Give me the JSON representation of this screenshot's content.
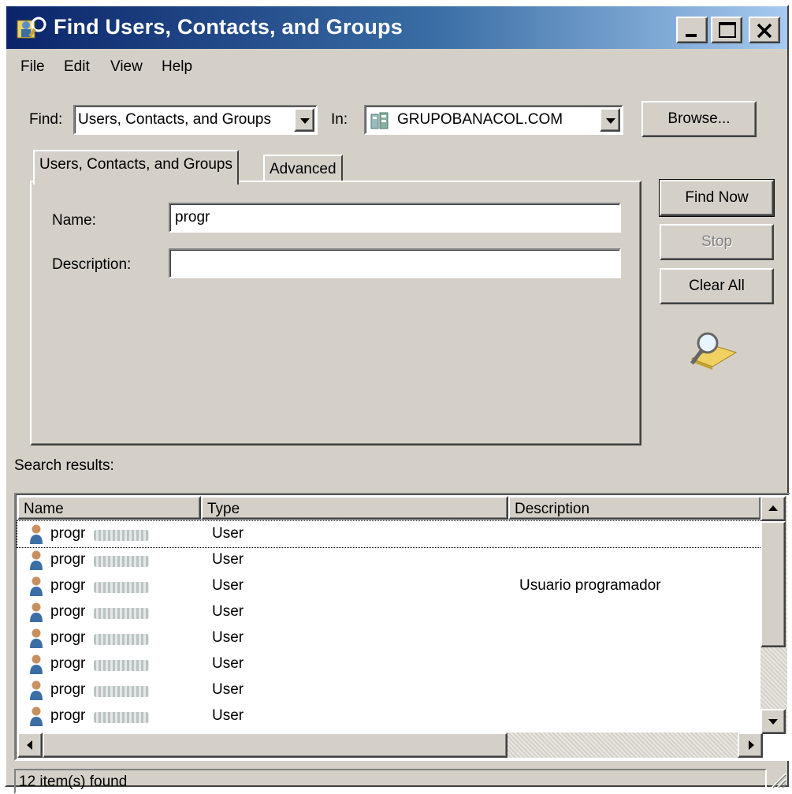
{
  "window": {
    "title": "Find Users, Contacts, and Groups",
    "minimize_glyph": "_",
    "maximize_glyph": "□",
    "close_glyph": "X",
    "icon": "find-users-icon"
  },
  "menu": [
    "File",
    "Edit",
    "View",
    "Help"
  ],
  "find_row": {
    "find_label": "Find:",
    "find_value": "Users, Contacts, and Groups",
    "in_label": "In:",
    "in_value": "GRUPOBANACOL.COM",
    "in_icon": "domain-icon",
    "browse_label": "Browse..."
  },
  "tabs": [
    "Users, Contacts, and Groups",
    "Advanced"
  ],
  "form": {
    "name_label": "Name:",
    "name_value": "progr",
    "description_label": "Description:",
    "description_value": ""
  },
  "buttons": {
    "find_now": "Find Now",
    "stop": "Stop",
    "clear_all": "Clear All",
    "search_icon": "magnifier-search-icon"
  },
  "results": {
    "label": "Search results:",
    "columns": [
      "Name",
      "Type",
      "Description"
    ],
    "rows": [
      {
        "name": "progr",
        "type": "User",
        "description": ""
      },
      {
        "name": "progr",
        "type": "User",
        "description": ""
      },
      {
        "name": "progr",
        "type": "User",
        "description": "Usuario programador"
      },
      {
        "name": "progr",
        "type": "User",
        "description": ""
      },
      {
        "name": "progr",
        "type": "User",
        "description": ""
      },
      {
        "name": "progr",
        "type": "User",
        "description": ""
      },
      {
        "name": "progr",
        "type": "User",
        "description": ""
      },
      {
        "name": "progr",
        "type": "User",
        "description": ""
      }
    ]
  },
  "status": "12 item(s) found",
  "colors": {
    "face": "#d4d0c8",
    "title_start": "#0a246a",
    "title_end": "#a6caf0"
  }
}
